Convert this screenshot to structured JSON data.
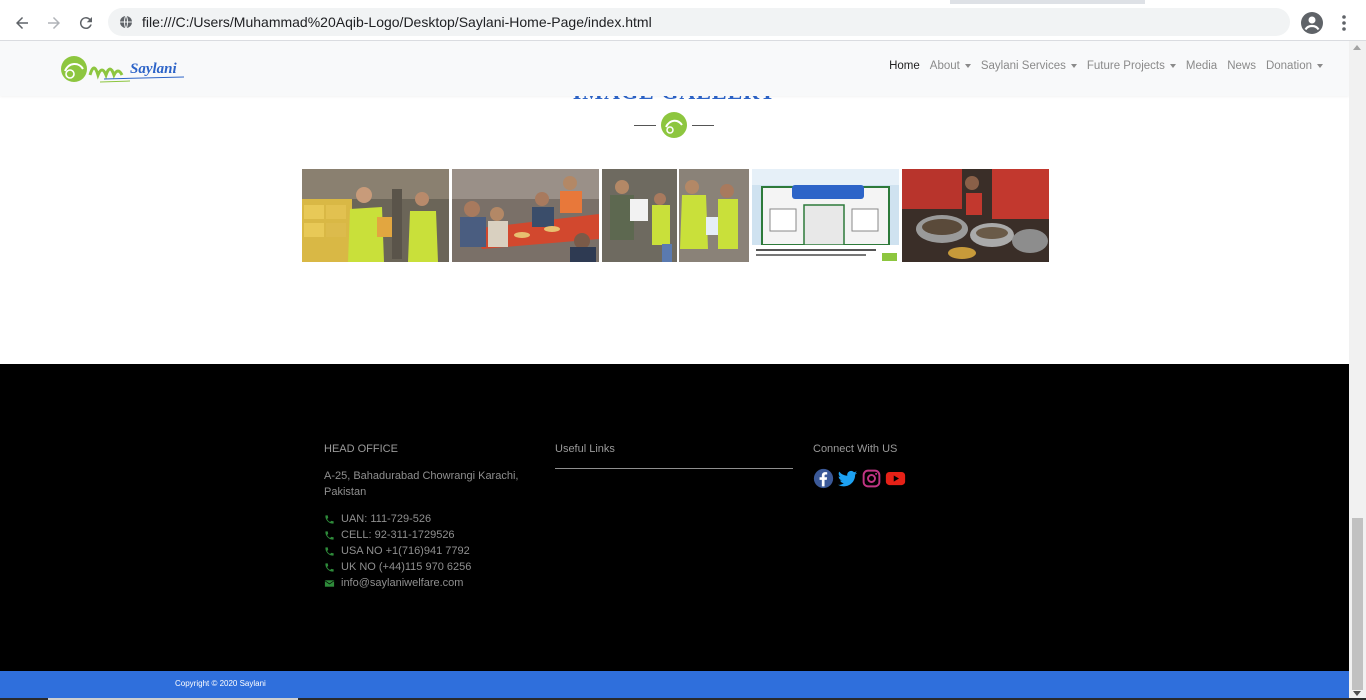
{
  "browser": {
    "url": "file:///C:/Users/Muhammad%20Aqib-Logo/Desktop/Saylani-Home-Page/index.html",
    "back_icon": "arrow-left-icon",
    "forward_icon": "arrow-right-icon",
    "reload_icon": "reload-icon",
    "site_icon": "globe-icon",
    "profile_icon": "account-circle-icon",
    "menu_icon": "more-vert-icon"
  },
  "navbar": {
    "logo_text": "Saylani",
    "items": [
      {
        "label": "Home",
        "active": true,
        "dropdown": false
      },
      {
        "label": "About",
        "active": false,
        "dropdown": true
      },
      {
        "label": "Saylani Services",
        "active": false,
        "dropdown": true
      },
      {
        "label": "Future Projects",
        "active": false,
        "dropdown": true
      },
      {
        "label": "Media",
        "active": false,
        "dropdown": false
      },
      {
        "label": "News",
        "active": false,
        "dropdown": false
      },
      {
        "label": "Donation",
        "active": false,
        "dropdown": true
      }
    ]
  },
  "gallery": {
    "heading": "IMAGE GALLERY",
    "images": [
      {
        "name": "gallery-image-warehouse-volunteers"
      },
      {
        "name": "gallery-image-dastarkhwan-meal"
      },
      {
        "name": "gallery-image-ration-distribution"
      },
      {
        "name": "gallery-image-ro-plant-inauguration"
      },
      {
        "name": "gallery-image-cooking-pots"
      }
    ]
  },
  "footer": {
    "head_office_title": "HEAD OFFICE",
    "address": "A-25, Bahadurabad Chowrangi Karachi, Pakistan",
    "contacts": [
      {
        "icon": "phone-icon",
        "text": "UAN: 111-729-526"
      },
      {
        "icon": "phone-icon",
        "text": "CELL: 92-311-1729526"
      },
      {
        "icon": "phone-icon",
        "text": "USA NO +1(716)941 7792"
      },
      {
        "icon": "phone-icon",
        "text": "UK NO (+44)115 970 6256"
      },
      {
        "icon": "envelope-icon",
        "text": "info@saylaniwelfare.com"
      }
    ],
    "useful_links_title": "Useful Links",
    "connect_title": "Connect With US",
    "socials": [
      "facebook-icon",
      "twitter-icon",
      "instagram-icon",
      "youtube-icon"
    ]
  },
  "copyright": "Copyright © 2020 Saylani",
  "colors": {
    "accent_blue": "#2f6fdc",
    "footer_bg": "#000000",
    "icon_green": "#2e8b3a",
    "facebook": "#3b5998",
    "twitter": "#1da1f2",
    "instagram": "#c13584",
    "youtube": "#e62117"
  }
}
